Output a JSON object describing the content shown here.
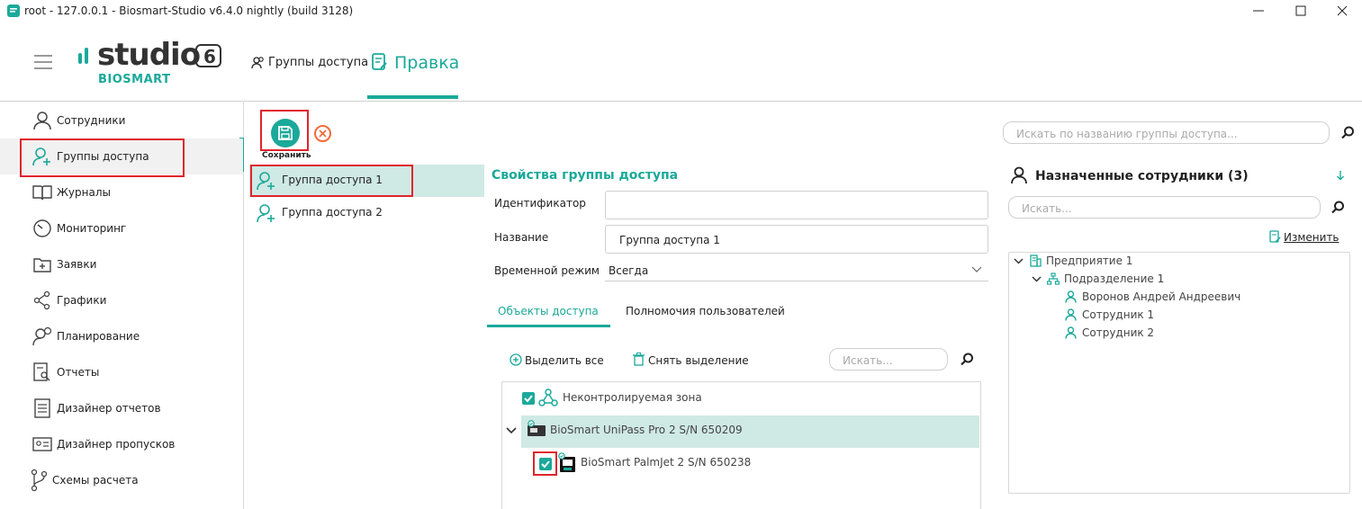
{
  "window": {
    "title": "root - 127.0.0.1 - Biosmart-Studio v6.4.0 nightly (build 3128)"
  },
  "header": {
    "logo_text": "studio",
    "logo_version": "6",
    "logo_brand": "BIOSMART",
    "tabs": [
      {
        "label": "Группы доступа",
        "active": false
      },
      {
        "label": "Правка",
        "active": true
      }
    ]
  },
  "sidebar": {
    "items": [
      {
        "label": "Сотрудники",
        "icon": "user-icon"
      },
      {
        "label": "Группы доступа",
        "icon": "user-group-icon",
        "active": true
      },
      {
        "label": "Журналы",
        "icon": "book-icon"
      },
      {
        "label": "Мониторинг",
        "icon": "gauge-icon"
      },
      {
        "label": "Заявки",
        "icon": "folder-plus-icon"
      },
      {
        "label": "Графики",
        "icon": "share-icon"
      },
      {
        "label": "Планирование",
        "icon": "user-clock-icon"
      },
      {
        "label": "Отчеты",
        "icon": "report-search-icon"
      },
      {
        "label": "Дизайнер отчетов",
        "icon": "report-designer-icon"
      },
      {
        "label": "Дизайнер пропусков",
        "icon": "id-card-icon"
      },
      {
        "label": "Схемы расчета",
        "icon": "branch-icon"
      }
    ]
  },
  "toolbar": {
    "save_label": "Сохранить"
  },
  "group_search": {
    "placeholder": "Искать по названию группы доступа..."
  },
  "groups": [
    {
      "label": "Группа доступа 1",
      "selected": true
    },
    {
      "label": "Группа доступа 2",
      "selected": false
    }
  ],
  "properties": {
    "title": "Свойства группы доступа",
    "id_label": "Идентификатор",
    "id_value": "",
    "name_label": "Название",
    "name_value": "Группа доступа 1",
    "schedule_label": "Временной режим",
    "schedule_value": "Всегда"
  },
  "subtabs": [
    {
      "label": "Объекты доступа",
      "active": true
    },
    {
      "label": "Полномочия пользователей",
      "active": false
    }
  ],
  "objects": {
    "select_all": "Выделить все",
    "deselect": "Снять выделение",
    "search_placeholder": "Искать...",
    "items": [
      {
        "label": "Неконтролируемая зона",
        "checked": true
      },
      {
        "label": "BioSmart UniPass Pro 2 S/N 650209",
        "expanded": true
      },
      {
        "label": "BioSmart PalmJet 2 S/N 650238",
        "checked": true
      }
    ]
  },
  "employees": {
    "title": "Назначенные сотрудники (3)",
    "search_placeholder": "Искать...",
    "change_label": "Изменить",
    "tree": [
      {
        "label": "Предприятие 1"
      },
      {
        "label": "Подразделение 1"
      },
      {
        "label": "Воронов Андрей Андреевич"
      },
      {
        "label": "Сотрудник 1"
      },
      {
        "label": "Сотрудник 2"
      }
    ]
  },
  "colors": {
    "accent": "#1aa99a",
    "selection": "#cfe9e5",
    "highlight": "#e0242b",
    "cancel": "#f06a3a"
  }
}
